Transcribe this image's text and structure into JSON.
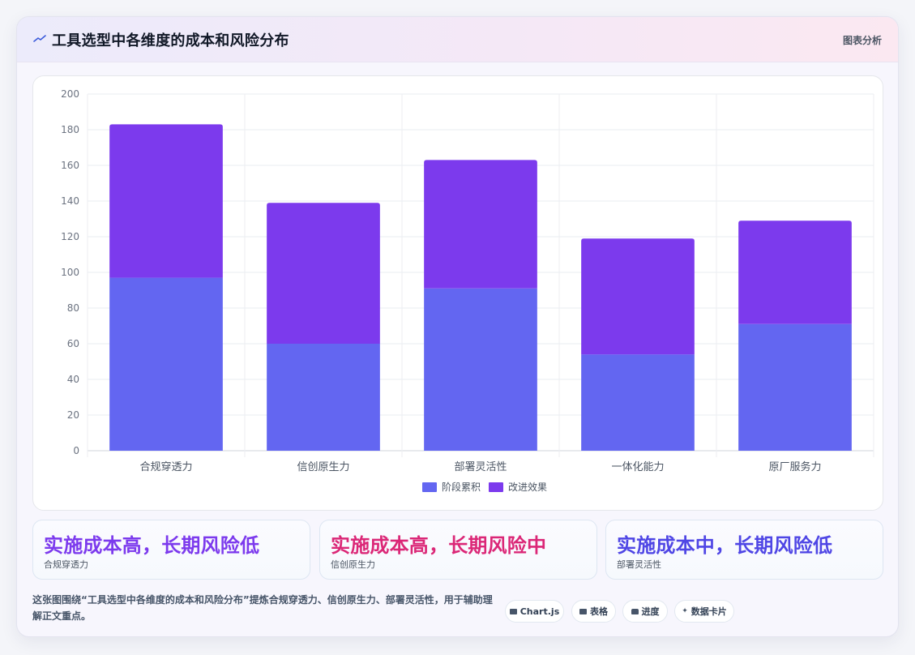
{
  "header": {
    "title": "工具选型中各维度的成本和风险分布",
    "tag": "图表分析"
  },
  "chart_data": {
    "type": "bar",
    "stacked": true,
    "categories": [
      "合规穿透力",
      "信创原生力",
      "部署灵活性",
      "一体化能力",
      "原厂服务力"
    ],
    "series": [
      {
        "name": "阶段累积",
        "values": [
          97,
          60,
          91,
          54,
          71
        ],
        "color": "#6366f1"
      },
      {
        "name": "改进效果",
        "values": [
          86,
          79,
          72,
          65,
          58
        ],
        "color": "#7c3aed"
      }
    ],
    "ylim": [
      0,
      200
    ],
    "yticks": [
      0,
      20,
      40,
      60,
      80,
      100,
      120,
      140,
      160,
      180,
      200
    ],
    "grid": true,
    "legend": "bottom"
  },
  "insights": [
    {
      "headline": "实施成本高，长期风险低",
      "sub": "合规穿透力",
      "color": "#7c3aed"
    },
    {
      "headline": "实施成本高，长期风险中",
      "sub": "信创原生力",
      "color": "#db2777"
    },
    {
      "headline": "实施成本中，长期风险低",
      "sub": "部署灵活性",
      "color": "#4f46e5"
    }
  ],
  "footer": {
    "description": "这张图围绕“工具选型中各维度的成本和风险分布”提炼合规穿透力、信创原生力、部署灵活性，用于辅助理解正文重点。",
    "chips": [
      {
        "icon": "chart-icon",
        "label": "Chart.js"
      },
      {
        "icon": "table-icon",
        "label": "表格"
      },
      {
        "icon": "progress-icon",
        "label": "进度"
      },
      {
        "icon": "sparkle-icon",
        "label": "数据卡片"
      }
    ]
  }
}
